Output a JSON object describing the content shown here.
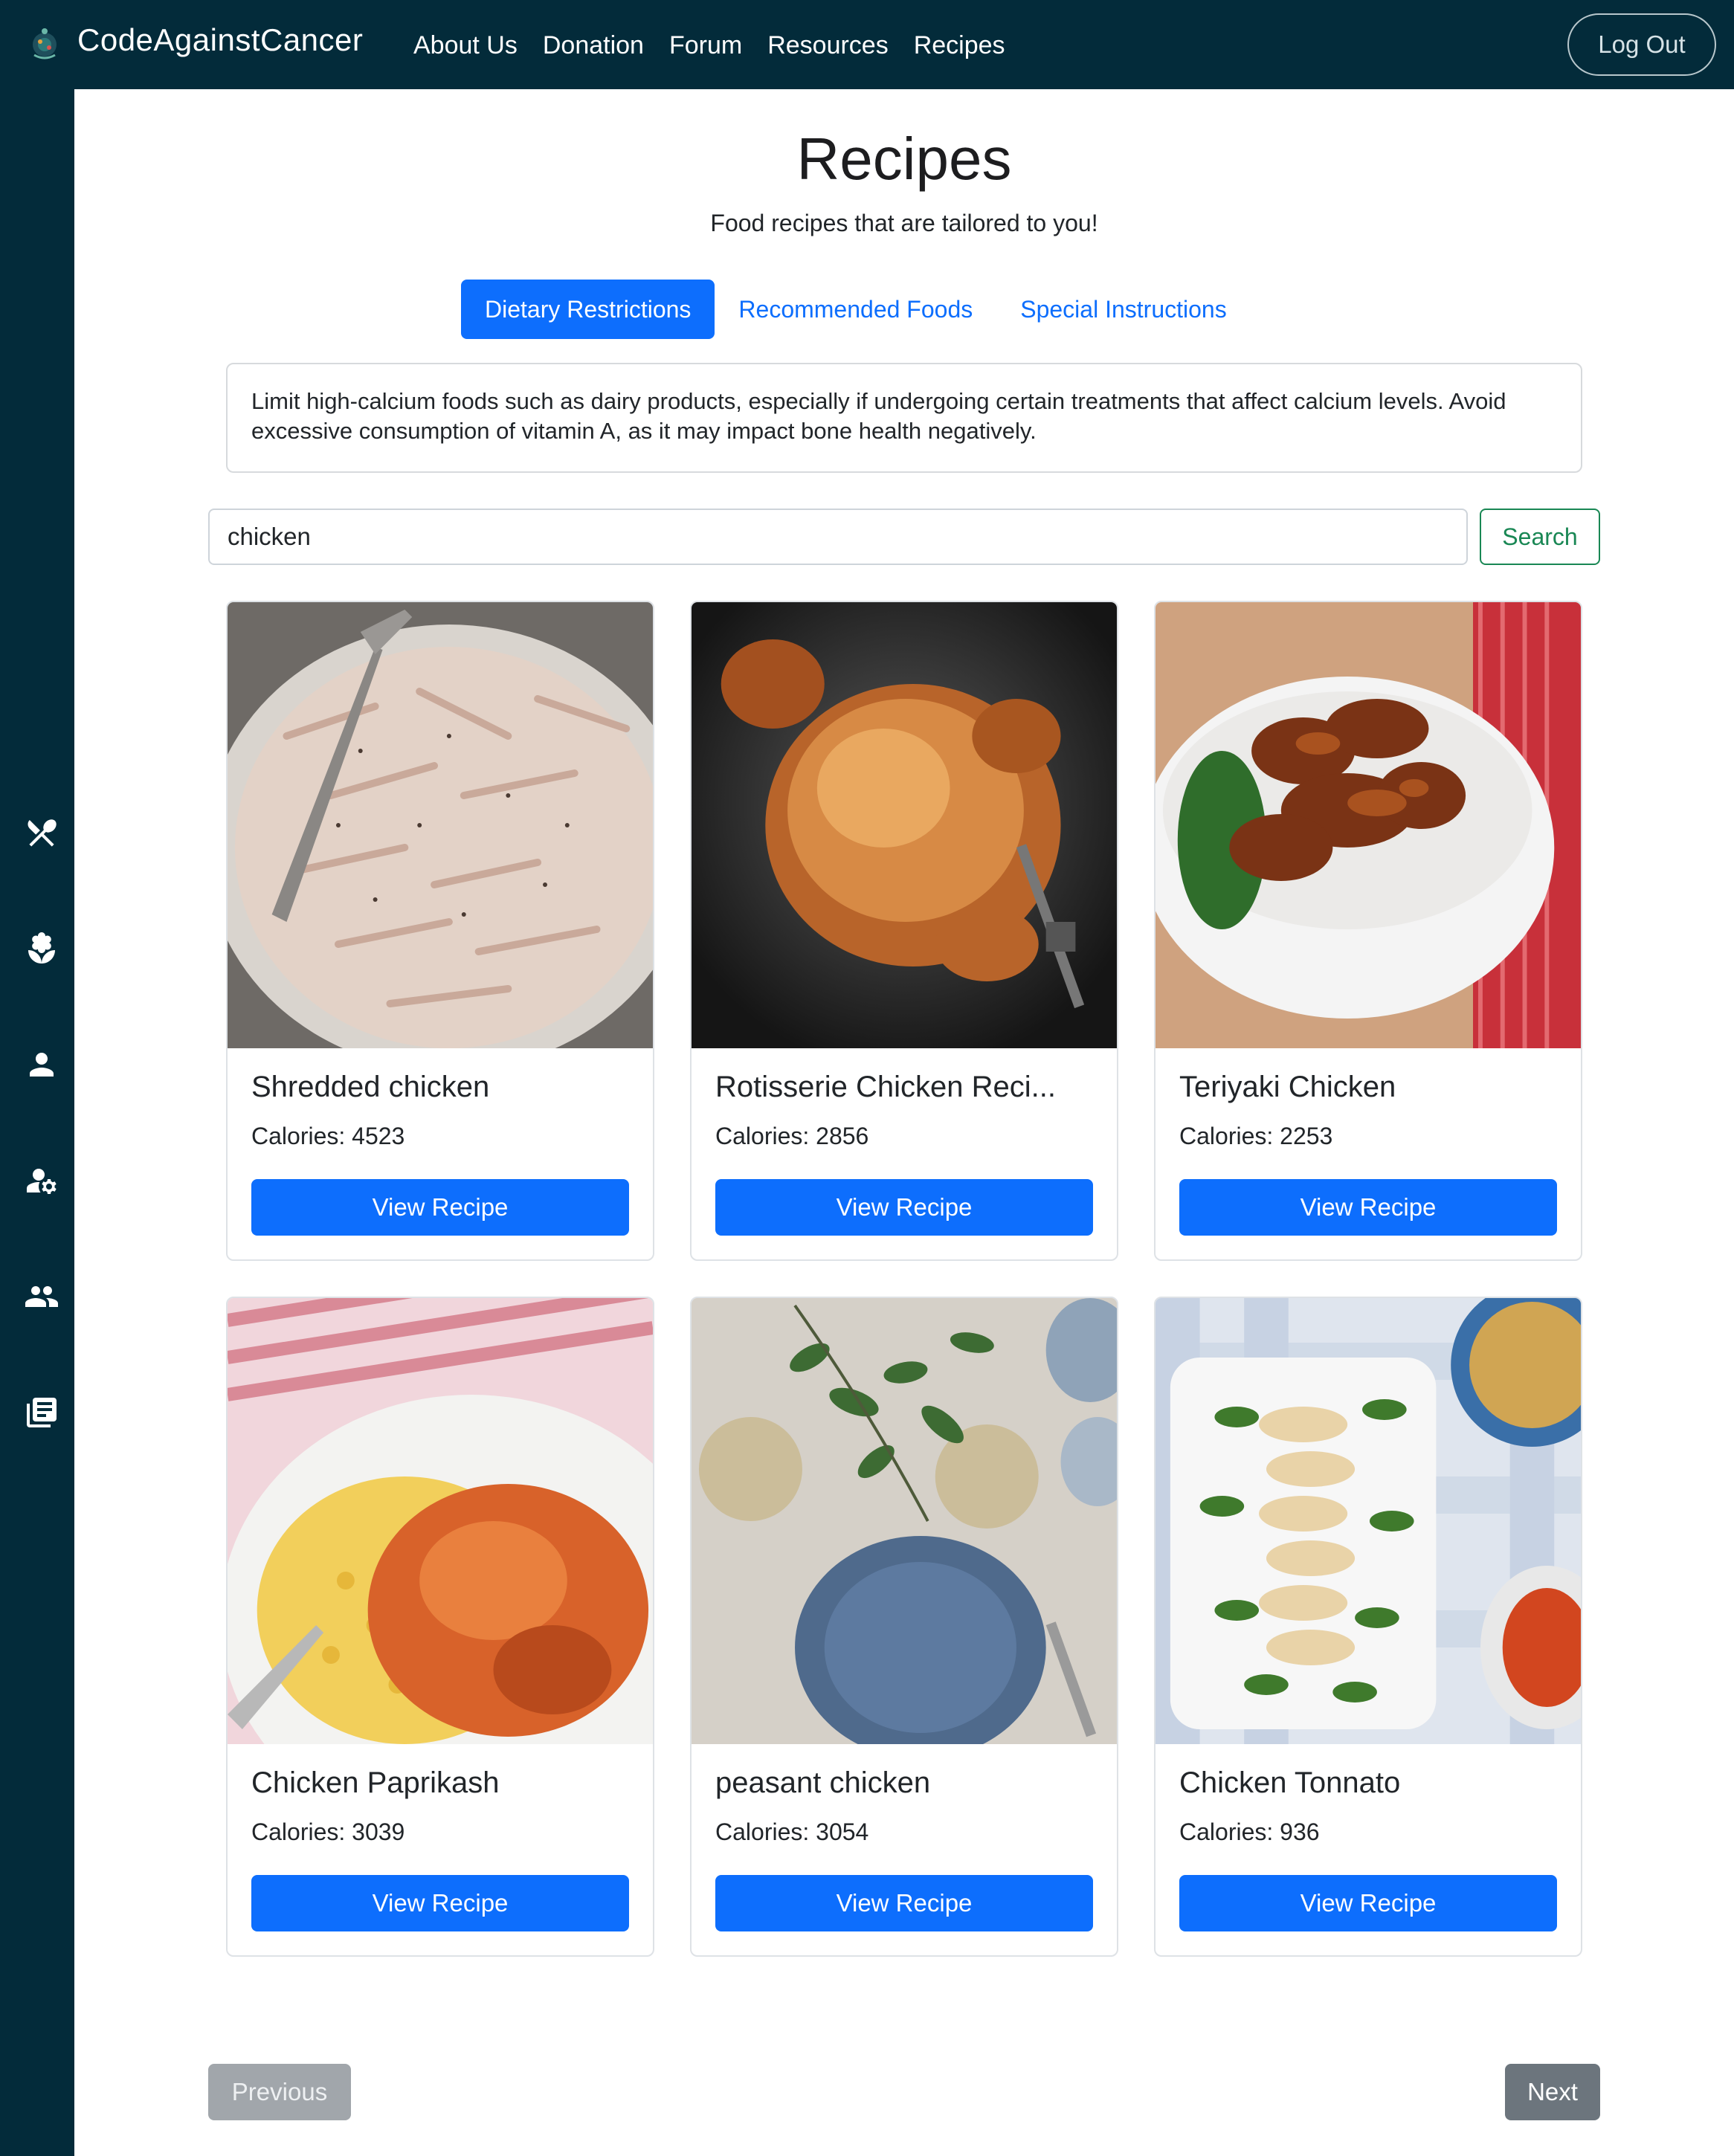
{
  "app": {
    "brand": "CodeAgainstCancer",
    "nav": [
      "About Us",
      "Donation",
      "Forum",
      "Resources",
      "Recipes"
    ],
    "logout_label": "Log Out"
  },
  "sidebar": {
    "icons": [
      "utensils-icon",
      "seedling-icon",
      "person-icon",
      "user-gear-icon",
      "people-icon",
      "library-icon"
    ]
  },
  "page": {
    "title": "Recipes",
    "subtitle": "Food recipes that are tailored to you!"
  },
  "tabs": [
    {
      "label": "Dietary Restrictions",
      "active": true
    },
    {
      "label": "Recommended Foods",
      "active": false
    },
    {
      "label": "Special Instructions",
      "active": false
    }
  ],
  "info_text": "Limit high-calcium foods such as dairy products, especially if undergoing certain treatments that affect calcium levels. Avoid excessive consumption of vitamin A, as it may impact bone health negatively.",
  "search": {
    "value": "chicken",
    "button_label": "Search"
  },
  "recipes": [
    {
      "title": "Shredded chicken",
      "calories": "Calories: 4523",
      "button": "View Recipe"
    },
    {
      "title": "Rotisserie Chicken Reci...",
      "calories": "Calories: 2856",
      "button": "View Recipe"
    },
    {
      "title": "Teriyaki Chicken",
      "calories": "Calories: 2253",
      "button": "View Recipe"
    },
    {
      "title": "Chicken Paprikash",
      "calories": "Calories: 3039",
      "button": "View Recipe"
    },
    {
      "title": "peasant chicken",
      "calories": "Calories: 3054",
      "button": "View Recipe"
    },
    {
      "title": "Chicken Tonnato",
      "calories": "Calories: 936",
      "button": "View Recipe"
    }
  ],
  "pagination": {
    "previous": "Previous",
    "next": "Next"
  },
  "colors": {
    "navbar": "#032b3a",
    "primary": "#0d6efd",
    "success": "#198754",
    "secondary": "#6c757d"
  }
}
